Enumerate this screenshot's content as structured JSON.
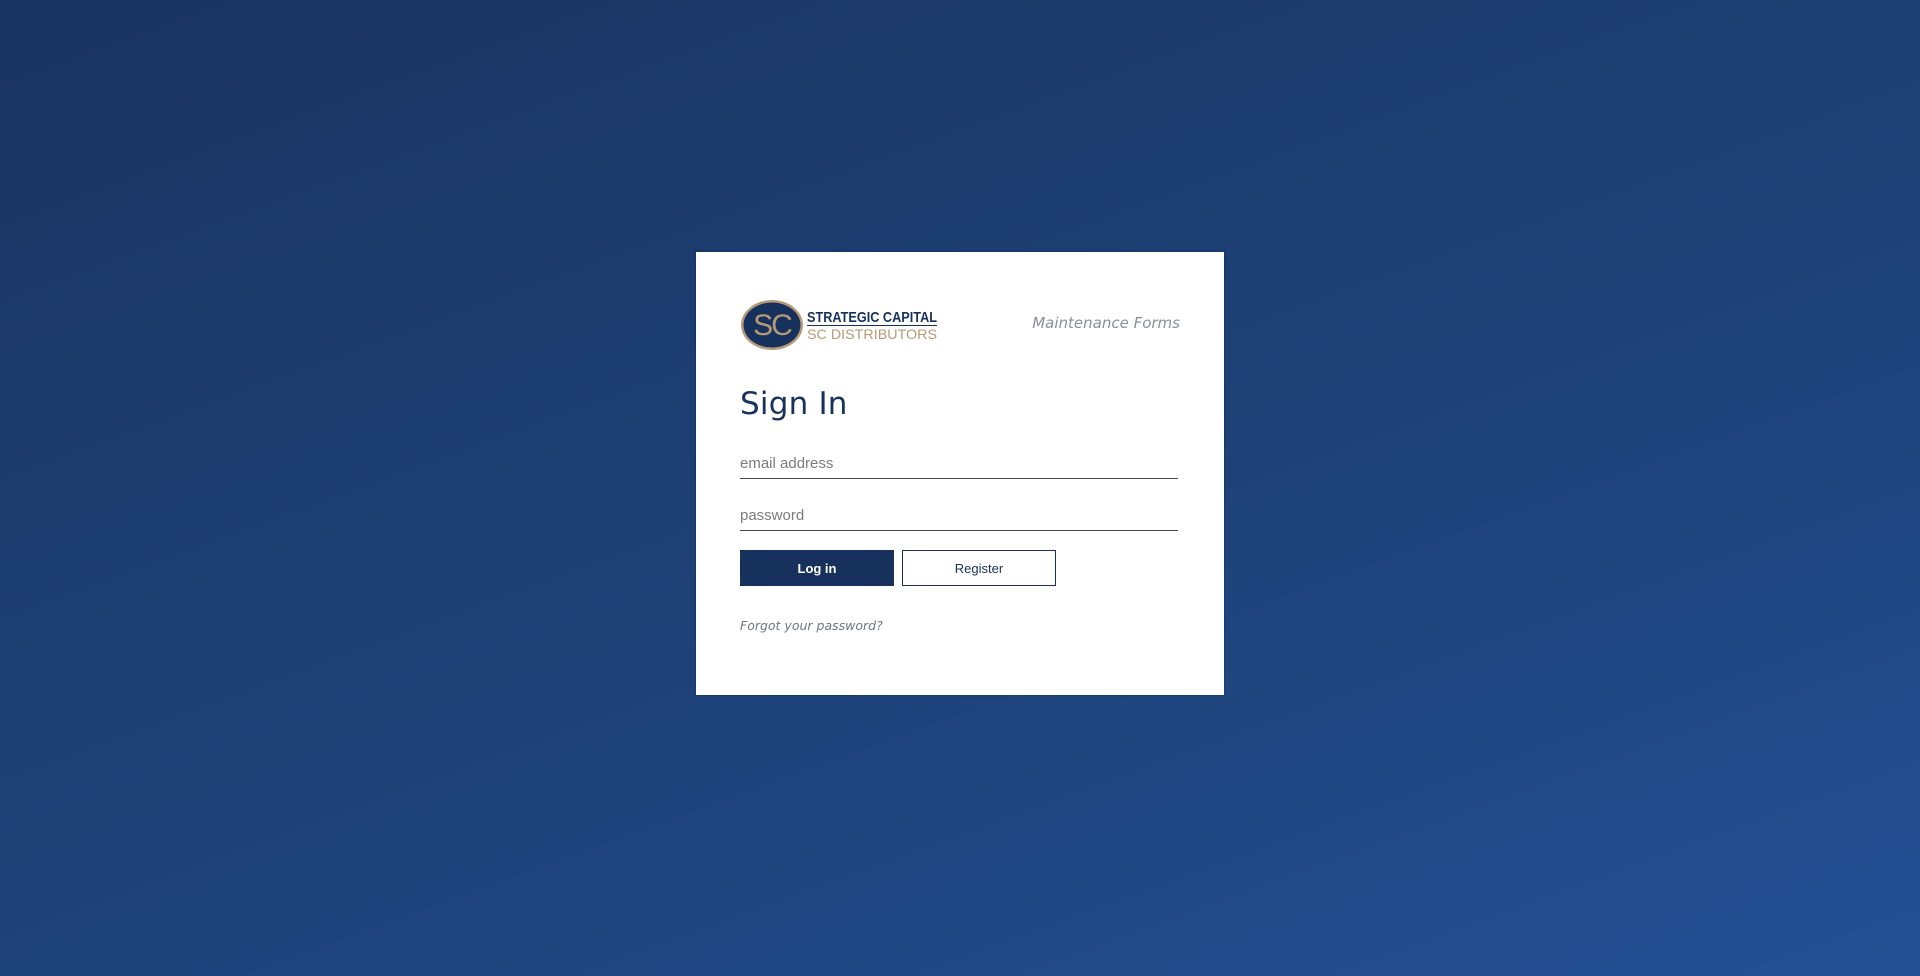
{
  "login_card": {
    "logo": {
      "icon": "sc-oval-logo",
      "monogram": "SC",
      "company_line_1": "STRATEGIC CAPITAL",
      "company_line_2": "SC DISTRIBUTORS",
      "navy": "#17315d",
      "gold": "#b69a78"
    },
    "app_name": "Maintenance Forms",
    "title": "Sign In",
    "email": {
      "value": "",
      "placeholder": "email address"
    },
    "password": {
      "value": "",
      "placeholder": "password"
    },
    "login_button": "Log in",
    "register_button": "Register",
    "forgot_link": "Forgot your password?"
  },
  "colors": {
    "primary": "#17315d",
    "background_top": "#1a3461",
    "background_bottom": "#234f94"
  }
}
